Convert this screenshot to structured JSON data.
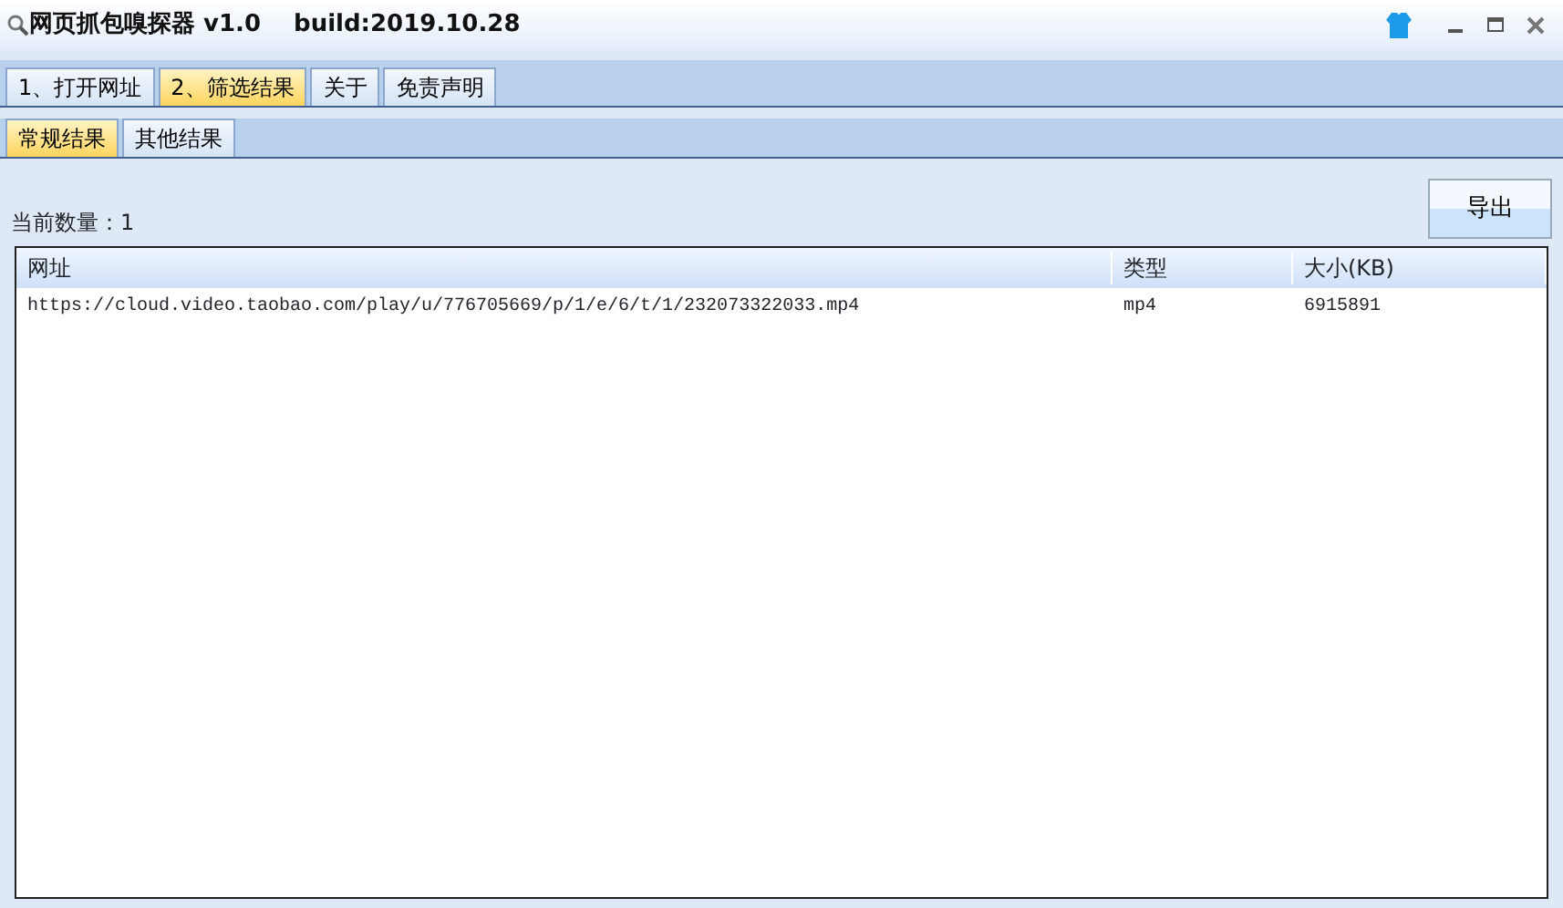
{
  "window": {
    "title": "网页抓包嗅探器 v1.0",
    "build": "build:2019.10.28"
  },
  "tabs": [
    {
      "label": "1、打开网址",
      "selected": false
    },
    {
      "label": "2、筛选结果",
      "selected": true
    },
    {
      "label": "关于",
      "selected": false
    },
    {
      "label": "免责声明",
      "selected": false
    }
  ],
  "subtabs": [
    {
      "label": "常规结果",
      "selected": true
    },
    {
      "label": "其他结果",
      "selected": false
    }
  ],
  "count": {
    "label": "当前数量：",
    "value": "1"
  },
  "export_button": "导出",
  "table": {
    "columns": [
      "网址",
      "类型",
      "大小(KB)"
    ],
    "rows": [
      [
        "https://cloud.video.taobao.com/play/u/776705669/p/1/e/6/t/1/232073322033.mp4",
        "mp4",
        "6915891"
      ]
    ]
  }
}
